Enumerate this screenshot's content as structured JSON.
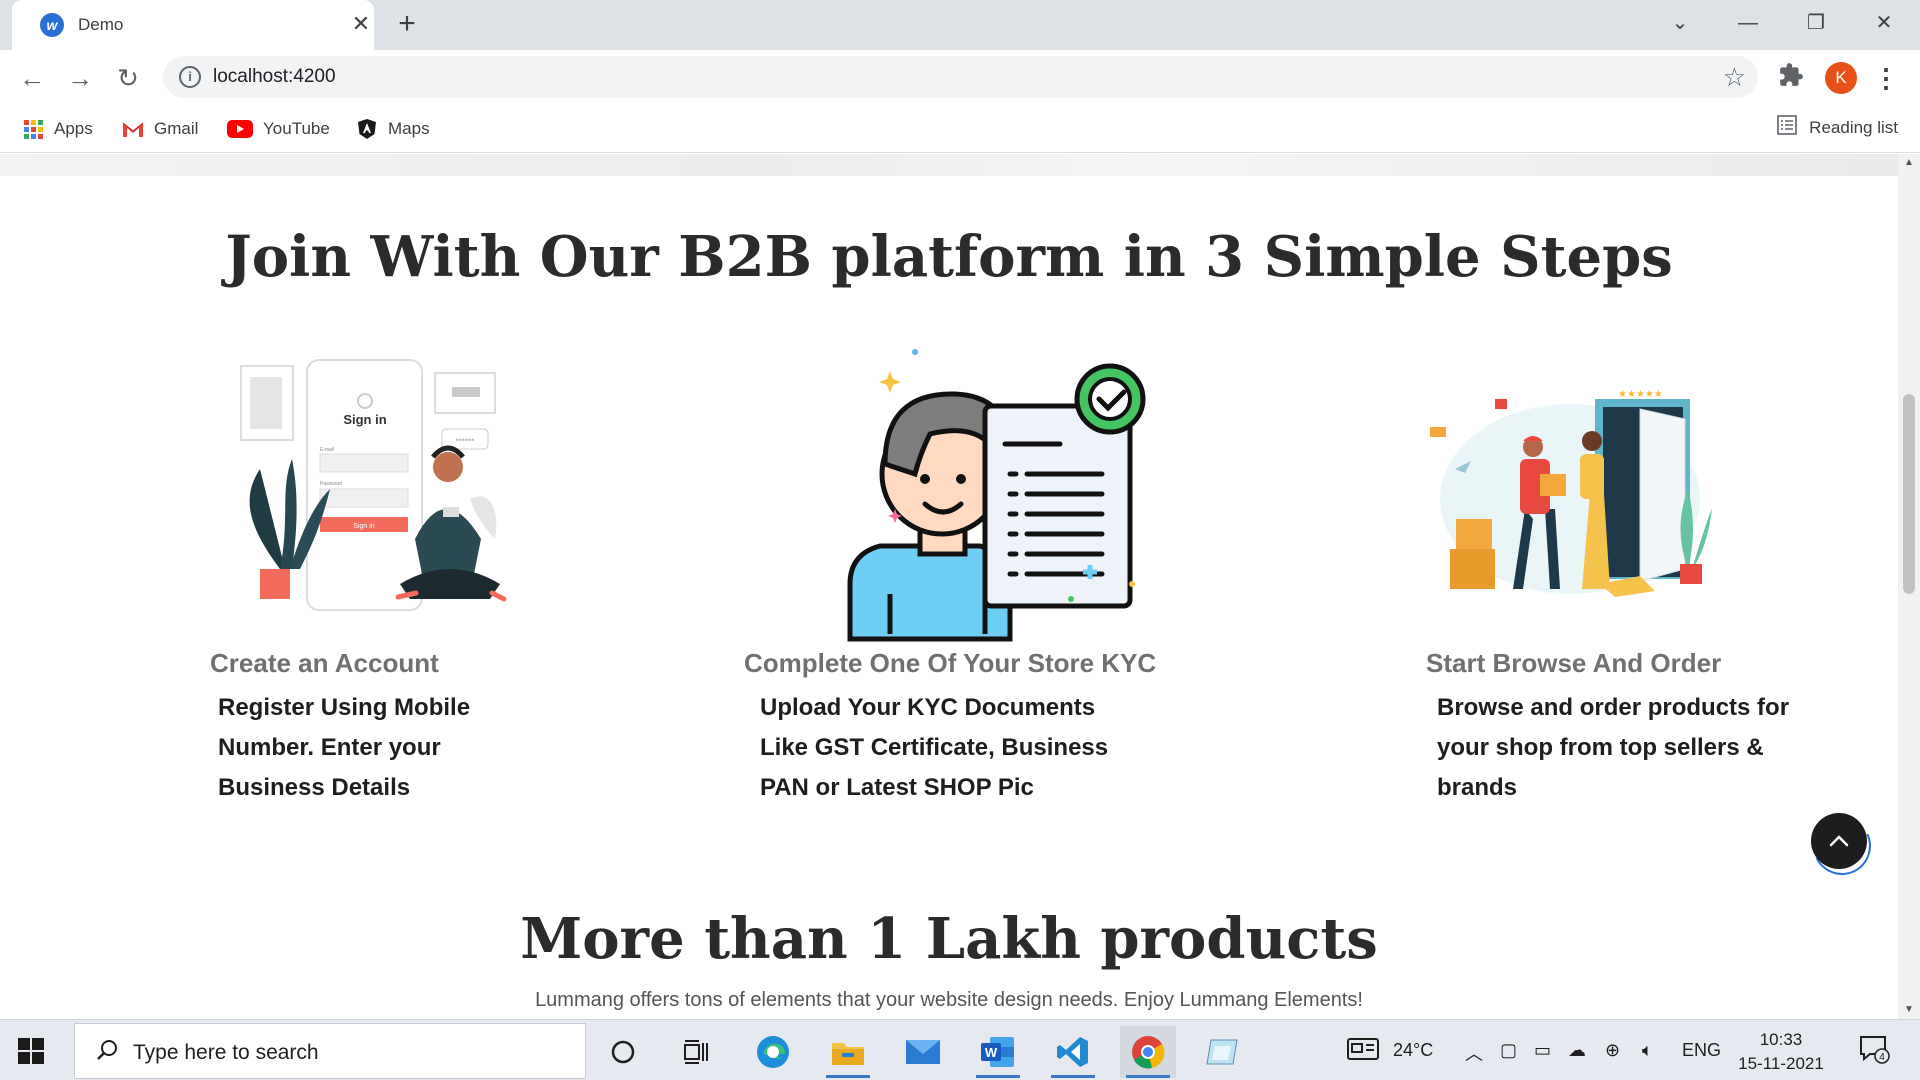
{
  "browser": {
    "tab_title": "Demo",
    "new_tab": "+",
    "url": "localhost:4200",
    "profile_initial": "K",
    "bookmarks": [
      {
        "label": "Apps",
        "icon": "apps-icon"
      },
      {
        "label": "Gmail",
        "icon": "gmail-icon"
      },
      {
        "label": "YouTube",
        "icon": "youtube-icon"
      },
      {
        "label": "Maps",
        "icon": "maps-icon"
      }
    ],
    "reading_list": "Reading list"
  },
  "page": {
    "steps_title": "Join With Our B2B platform in 3 Simple Steps",
    "steps": [
      {
        "heading": "Create an Account",
        "desc_lines": [
          "Register Using Mobile",
          "Number. Enter your",
          "Business Details"
        ],
        "illustration_text": "Sign in",
        "illustration_button": "Sign in",
        "illustration_email": "E-mail",
        "illustration_password": "Password"
      },
      {
        "heading": "Complete One Of Your Store KYC",
        "desc_lines": [
          "Upload Your KYC Documents",
          "Like GST Certificate, Business",
          "PAN or Latest SHOP Pic"
        ]
      },
      {
        "heading": "Start Browse And Order",
        "desc_lines": [
          "Browse and order products for",
          "your shop from top sellers &",
          "brands"
        ]
      }
    ],
    "products_title": "More than 1 Lakh products",
    "products_subtitle": "Lummang offers tons of elements that your website design needs. Enjoy Lummang Elements!"
  },
  "taskbar": {
    "search_placeholder": "Type here to search",
    "weather": "24°C",
    "language": "ENG",
    "time": "10:33",
    "date": "15-11-2021",
    "notification_count": "4"
  },
  "colors": {
    "accent_blue": "#2b6fe0",
    "profile_orange": "#e8501a",
    "heading_dark": "#2b2b2b",
    "step_heading_gray": "#707070"
  }
}
